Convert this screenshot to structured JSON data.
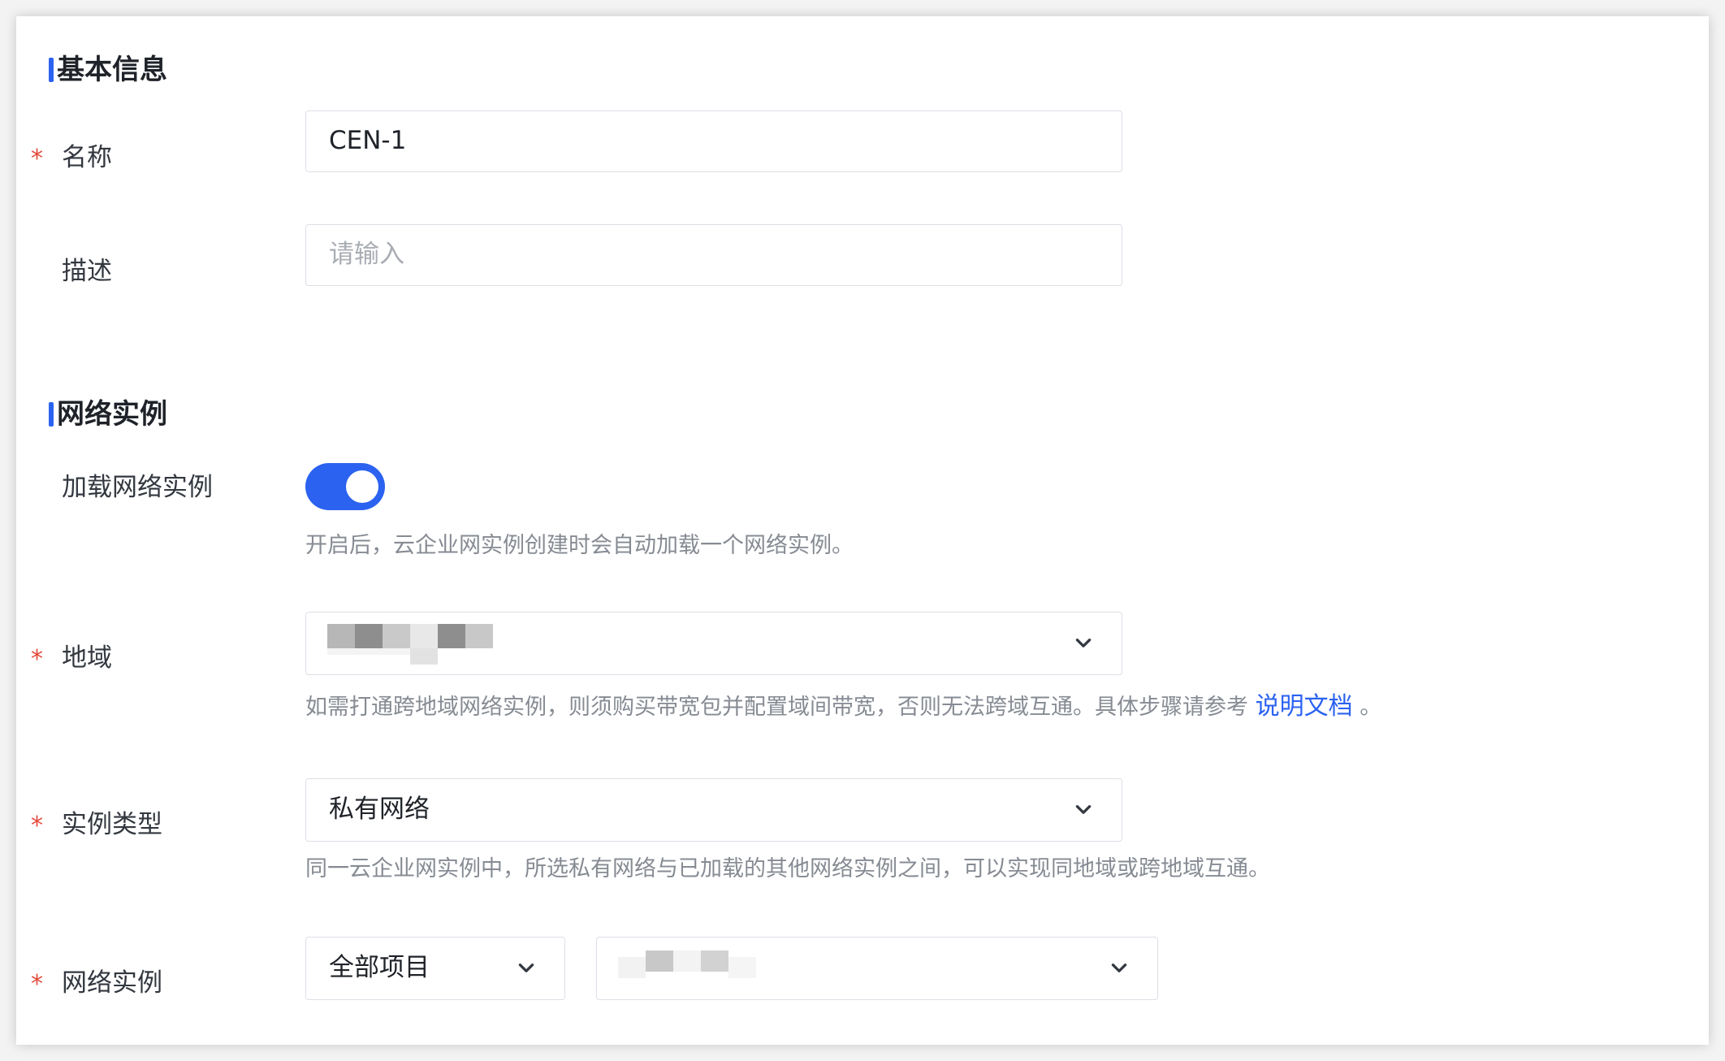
{
  "basic_info": {
    "section_title": "基本信息",
    "name_label": "名称",
    "name_value": "CEN-1",
    "desc_label": "描述",
    "desc_placeholder": "请输入"
  },
  "network_instance": {
    "section_title": "网络实例",
    "load_label": "加载网络实例",
    "load_enabled": true,
    "load_help": "开启后，云企业网实例创建时会自动加载一个网络实例。",
    "region_label": "地域",
    "region_help": "如需打通跨地域网络实例，则须购买带宽包并配置域间带宽，否则无法跨域互通。具体步骤请参考",
    "region_help_link": "说明文档",
    "region_help_suffix": "。",
    "type_label": "实例类型",
    "type_value": "私有网络",
    "type_help": "同一云企业网实例中，所选私有网络与已加载的其他网络实例之间，可以实现同地域或跨地域互通。",
    "instance_label": "网络实例",
    "project_value": "全部项目"
  },
  "required_mark": "*",
  "colors": {
    "accent": "#2b62f0",
    "required": "#e34a3b",
    "help_text": "#868b93",
    "border": "#dcdfe6"
  }
}
